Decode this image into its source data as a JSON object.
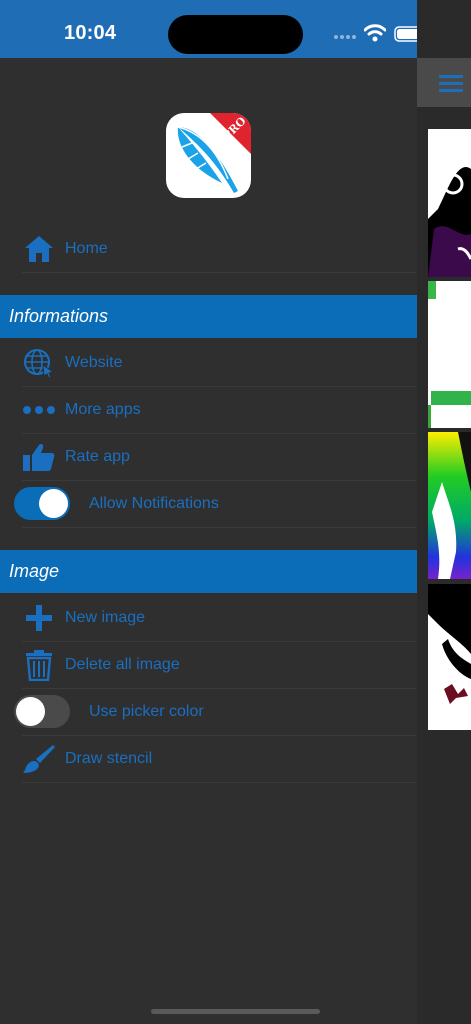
{
  "status_bar": {
    "time": "10:04"
  },
  "app_icon": {
    "badge": "PRO",
    "name": "feather-app-icon"
  },
  "menu": {
    "home_label": "Home"
  },
  "sections": {
    "informations": {
      "title": "Informations",
      "website": "Website",
      "more_apps": "More apps",
      "rate_app": "Rate app",
      "allow_notifications": "Allow Notifications",
      "allow_notifications_on": true
    },
    "image": {
      "title": "Image",
      "new_image": "New image",
      "delete_all_image": "Delete all image",
      "use_picker_color": "Use picker color",
      "use_picker_color_on": false,
      "draw_stencil": "Draw stencil"
    }
  },
  "colors": {
    "status_bar": "#1f6db4",
    "accent": "#0b6cb7",
    "label": "#1a6fc0",
    "background": "#2f2f2f"
  }
}
